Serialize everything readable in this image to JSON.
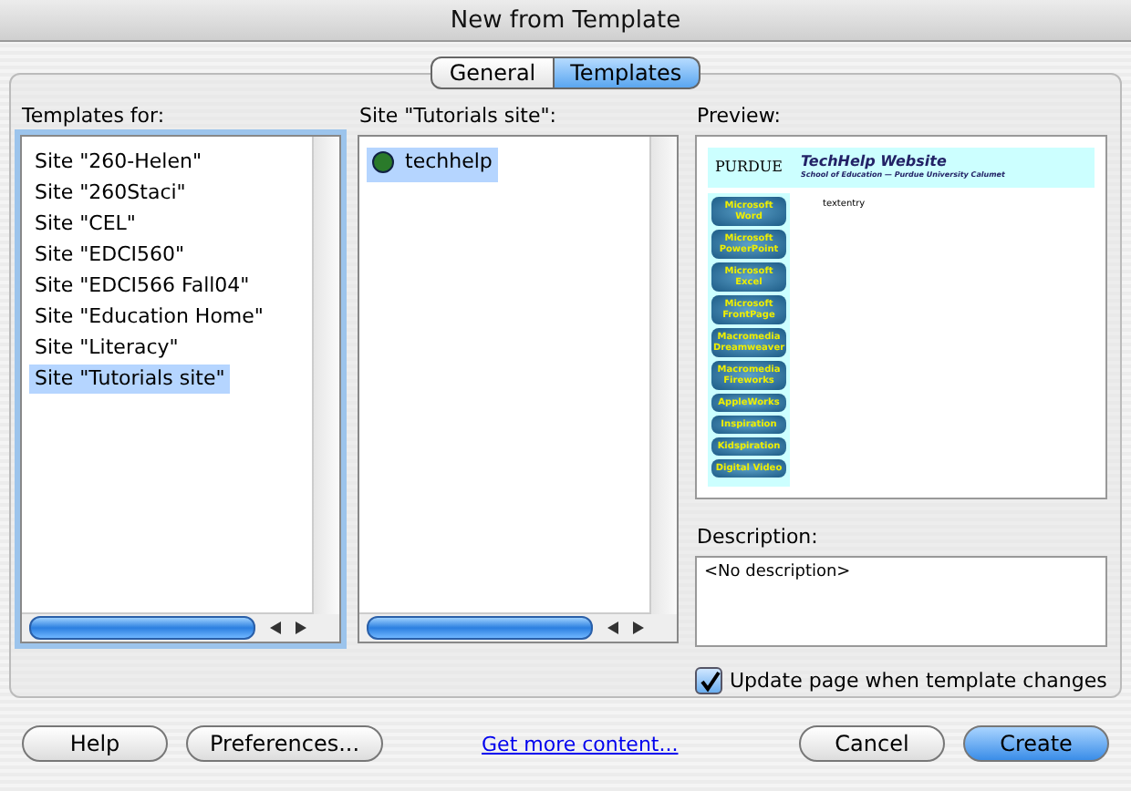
{
  "window": {
    "title": "New from Template"
  },
  "tabs": [
    {
      "label": "General",
      "selected": false
    },
    {
      "label": "Templates",
      "selected": true
    }
  ],
  "templates_for": {
    "label": "Templates for:",
    "items": [
      {
        "label": "Site \"260-Helen\"",
        "selected": false
      },
      {
        "label": "Site \"260Staci\"",
        "selected": false
      },
      {
        "label": "Site \"CEL\"",
        "selected": false
      },
      {
        "label": "Site \"EDCI560\"",
        "selected": false
      },
      {
        "label": "Site \"EDCI566 Fall04\"",
        "selected": false
      },
      {
        "label": "Site \"Education Home\"",
        "selected": false
      },
      {
        "label": "Site \"Literacy\"",
        "selected": false
      },
      {
        "label": "Site \"Tutorials site\"",
        "selected": true
      }
    ]
  },
  "site_list": {
    "label": "Site \"Tutorials site\":",
    "items": [
      {
        "label": "techhelp",
        "selected": true
      }
    ]
  },
  "preview": {
    "label": "Preview:",
    "logo": "PURDUE",
    "title": "TechHelp Website",
    "subtitle": "School of Education — Purdue University Calumet",
    "body": "textentry",
    "nav": [
      "Microsoft Word",
      "Microsoft PowerPoint",
      "Microsoft Excel",
      "Microsoft FrontPage",
      "Macromedia Dreamweaver",
      "Macromedia Fireworks",
      "AppleWorks",
      "Inspiration",
      "Kidspiration",
      "Digital Video"
    ]
  },
  "description": {
    "label": "Description:",
    "value": "<No description>"
  },
  "update_checkbox": {
    "label": "Update page when template changes",
    "checked": true
  },
  "buttons": {
    "help": "Help",
    "preferences": "Preferences...",
    "link": "Get more content...",
    "cancel": "Cancel",
    "create": "Create"
  }
}
